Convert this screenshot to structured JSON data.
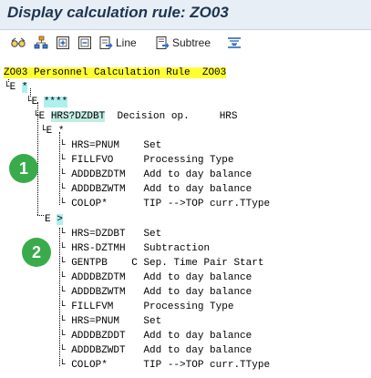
{
  "window": {
    "title": "Display calculation rule: ZO03"
  },
  "toolbar": {
    "items": [
      {
        "icon": "glasses-icon"
      },
      {
        "icon": "hierarchy-icon"
      },
      {
        "icon": "expand-icon"
      },
      {
        "icon": "collapse-icon"
      },
      {
        "icon": "line-icon",
        "label": "Line"
      },
      {
        "icon": "subtree-icon",
        "label": "Subtree"
      },
      {
        "icon": "align-icon"
      }
    ]
  },
  "tree": {
    "root": {
      "code": "ZO03",
      "text": "Personnel Calculation Rule",
      "rule": "ZO03"
    },
    "level1": {
      "marker": "E",
      "value": "*"
    },
    "level2": {
      "marker": "E",
      "value": "****"
    },
    "decision": {
      "marker": "E",
      "op": "HRS?DZDBT",
      "text": "Decision op.",
      "arg": "HRS"
    },
    "branch1": {
      "marker": "E",
      "value": "*",
      "badge": "1",
      "rows": [
        {
          "op": "HRS=PNUM",
          "text": "Set"
        },
        {
          "op": "FILLFVO",
          "text": "Processing Type"
        },
        {
          "op": "ADDDBZDTM",
          "text": "Add to day balance"
        },
        {
          "op": "ADDDBZWTM",
          "text": "Add to day balance"
        },
        {
          "op": "COLOP*",
          "text": "TIP -->TOP curr.TType"
        }
      ]
    },
    "branch2": {
      "marker": "E",
      "value": ">",
      "badge": "2",
      "rows": [
        {
          "op": "HRS=DZDBT",
          "text": "Set"
        },
        {
          "op": "HRS-DZTMH",
          "text": "Subtraction"
        },
        {
          "op": "GENTPB",
          "flag": "C",
          "text": "Sep. Time Pair Start"
        },
        {
          "op": "ADDDBZDTM",
          "text": "Add to day balance"
        },
        {
          "op": "ADDDBZWTM",
          "text": "Add to day balance"
        },
        {
          "op": "FILLFVM",
          "text": "Processing Type"
        },
        {
          "op": "HRS=PNUM",
          "text": "Set"
        },
        {
          "op": "ADDDBZDDT",
          "text": "Add to day balance"
        },
        {
          "op": "ADDDBZWDT",
          "text": "Add to day balance"
        },
        {
          "op": "COLOP*",
          "text": "TIP -->TOP curr.TType"
        }
      ]
    }
  }
}
